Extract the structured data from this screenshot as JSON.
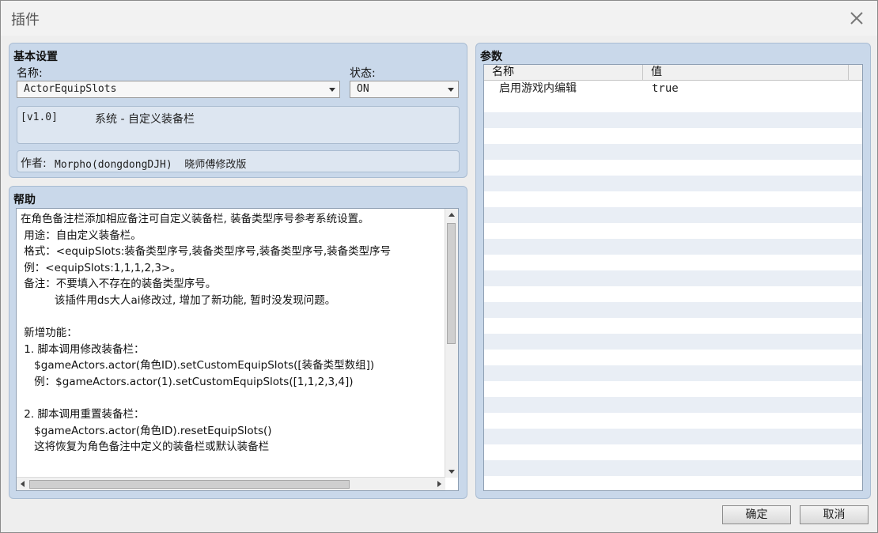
{
  "window": {
    "title": "插件"
  },
  "basic": {
    "section_title": "基本设置",
    "name_label": "名称:",
    "name_value": "ActorEquipSlots",
    "status_label": "状态:",
    "status_value": "ON",
    "description_version": "[v1.0]",
    "description_text": "系统 - 自定义装备栏",
    "author_label": "作者:",
    "author_value": "Morpho(dongdongDJH)  晓师傅修改版"
  },
  "help": {
    "section_title": "帮助",
    "text": "在角色备注栏添加相应备注可自定义装备栏, 装备类型序号参考系统设置。\n 用途：自由定义装备栏。\n 格式：<equipSlots:装备类型序号,装备类型序号,装备类型序号,装备类型序号\n 例：<equipSlots:1,1,1,2,3>。\n 备注：不要填入不存在的装备类型序号。\n          该插件用ds大人ai修改过, 增加了新功能, 暂时没发现问题。\n\n 新增功能：\n 1. 脚本调用修改装备栏：\n    $gameActors.actor(角色ID).setCustomEquipSlots([装备类型数组])\n    例：$gameActors.actor(1).setCustomEquipSlots([1,1,2,3,4])\n\n 2. 脚本调用重置装备栏：\n    $gameActors.actor(角色ID).resetEquipSlots()\n    这将恢复为角色备注中定义的装备栏或默认装备栏"
  },
  "params": {
    "section_title": "参数",
    "columns": [
      "名称",
      "值"
    ],
    "rows": [
      {
        "name": "启用游戏内编辑",
        "value": "true"
      }
    ]
  },
  "buttons": {
    "ok": "确定",
    "cancel": "取消"
  },
  "icons": {
    "close": "close-icon",
    "dropdown": "chevron-down-icon"
  }
}
